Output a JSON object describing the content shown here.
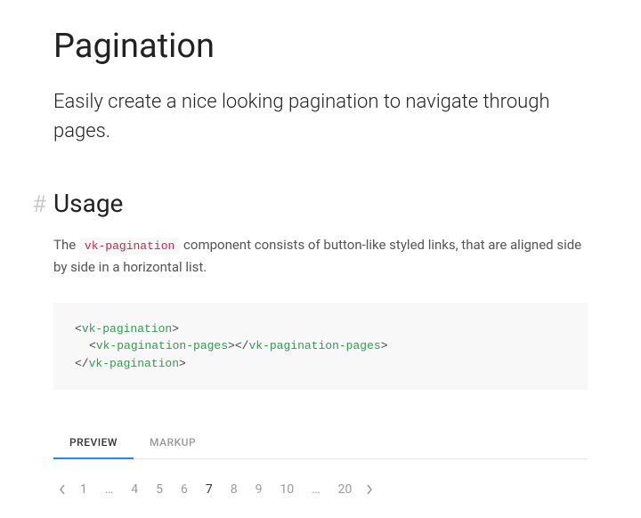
{
  "title": "Pagination",
  "lead": "Easily create a nice looking pagination to navigate through pages.",
  "section": {
    "hash": "#",
    "heading": "Usage",
    "text_before": "The ",
    "code_inline": "vk-pagination",
    "text_after": " component consists of button-like styled links, that are aligned side by side in a horizontal list."
  },
  "code": {
    "open_tag": "vk-pagination",
    "child_tag": "vk-pagination-pages",
    "close_tag": "vk-pagination",
    "lt": "<",
    "gt": ">",
    "lt_slash": "</"
  },
  "tabs": {
    "preview": "PREVIEW",
    "markup": "MARKUP"
  },
  "pagination": {
    "items": [
      {
        "label": "1",
        "type": "page"
      },
      {
        "label": "…",
        "type": "ellipsis"
      },
      {
        "label": "4",
        "type": "page"
      },
      {
        "label": "5",
        "type": "page"
      },
      {
        "label": "6",
        "type": "page"
      },
      {
        "label": "7",
        "type": "page",
        "current": true
      },
      {
        "label": "8",
        "type": "page"
      },
      {
        "label": "9",
        "type": "page"
      },
      {
        "label": "10",
        "type": "page"
      },
      {
        "label": "…",
        "type": "ellipsis"
      },
      {
        "label": "20",
        "type": "page"
      }
    ]
  }
}
